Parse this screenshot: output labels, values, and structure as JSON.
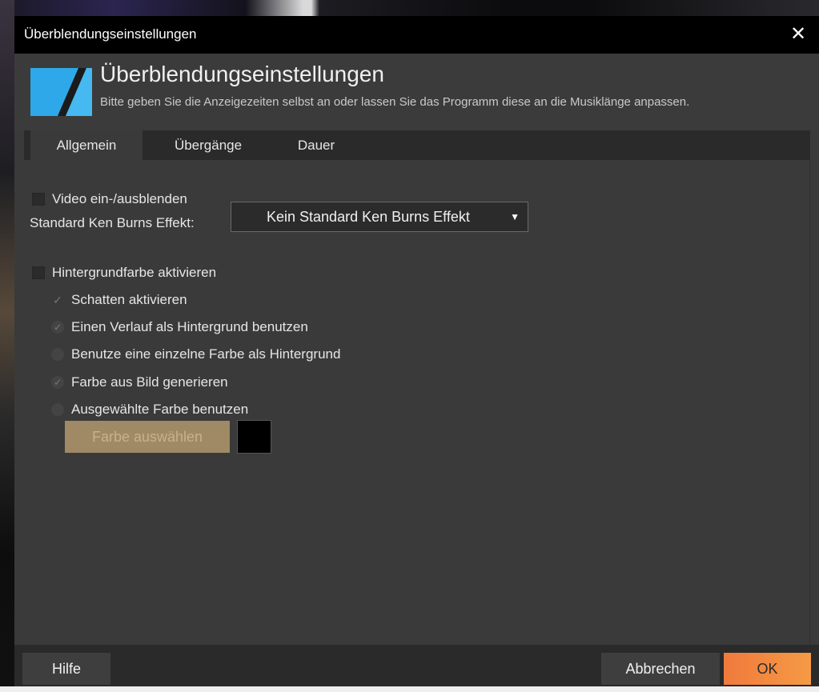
{
  "window": {
    "title": "Überblendungseinstellungen",
    "close_glyph": "✕"
  },
  "header": {
    "title": "Überblendungseinstellungen",
    "subtitle": "Bitte geben Sie die Anzeigezeiten selbst an oder lassen Sie das Programm diese an die Musiklänge anpassen.",
    "logo_icon": "app-logo-icon"
  },
  "tabs": [
    {
      "label": "Allgemein",
      "active": true
    },
    {
      "label": "Übergänge",
      "active": false
    },
    {
      "label": "Dauer",
      "active": false
    }
  ],
  "general": {
    "video_fade": {
      "label": "Video ein-/ausblenden",
      "checked": false
    },
    "ken_burns_label": "Standard Ken Burns Effekt:",
    "ken_burns_value": "Kein Standard Ken Burns Effekt",
    "bg_color": {
      "label": "Hintergrundfarbe aktivieren",
      "checked": false
    },
    "shadow": {
      "label": "Schatten aktivieren",
      "checked": true,
      "enabled": false
    },
    "gradient_bg": {
      "label": "Einen Verlauf als Hintergrund benutzen",
      "selected": true,
      "enabled": false
    },
    "single_color_bg": {
      "label": "Benutze eine einzelne Farbe als Hintergrund",
      "selected": false,
      "enabled": false
    },
    "color_from_image": {
      "label": "Farbe aus Bild generieren",
      "selected": true,
      "enabled": false
    },
    "selected_color": {
      "label": "Ausgewählte Farbe benutzen",
      "selected": false,
      "enabled": false
    },
    "pick_color_button": "Farbe auswählen",
    "swatch_color": "#000000"
  },
  "footer": {
    "help": "Hilfe",
    "cancel": "Abbrechen",
    "ok": "OK"
  },
  "colors": {
    "accent": "#f58a40",
    "dialog_bg": "#3a3a3a",
    "titlebar_bg": "#000000"
  }
}
